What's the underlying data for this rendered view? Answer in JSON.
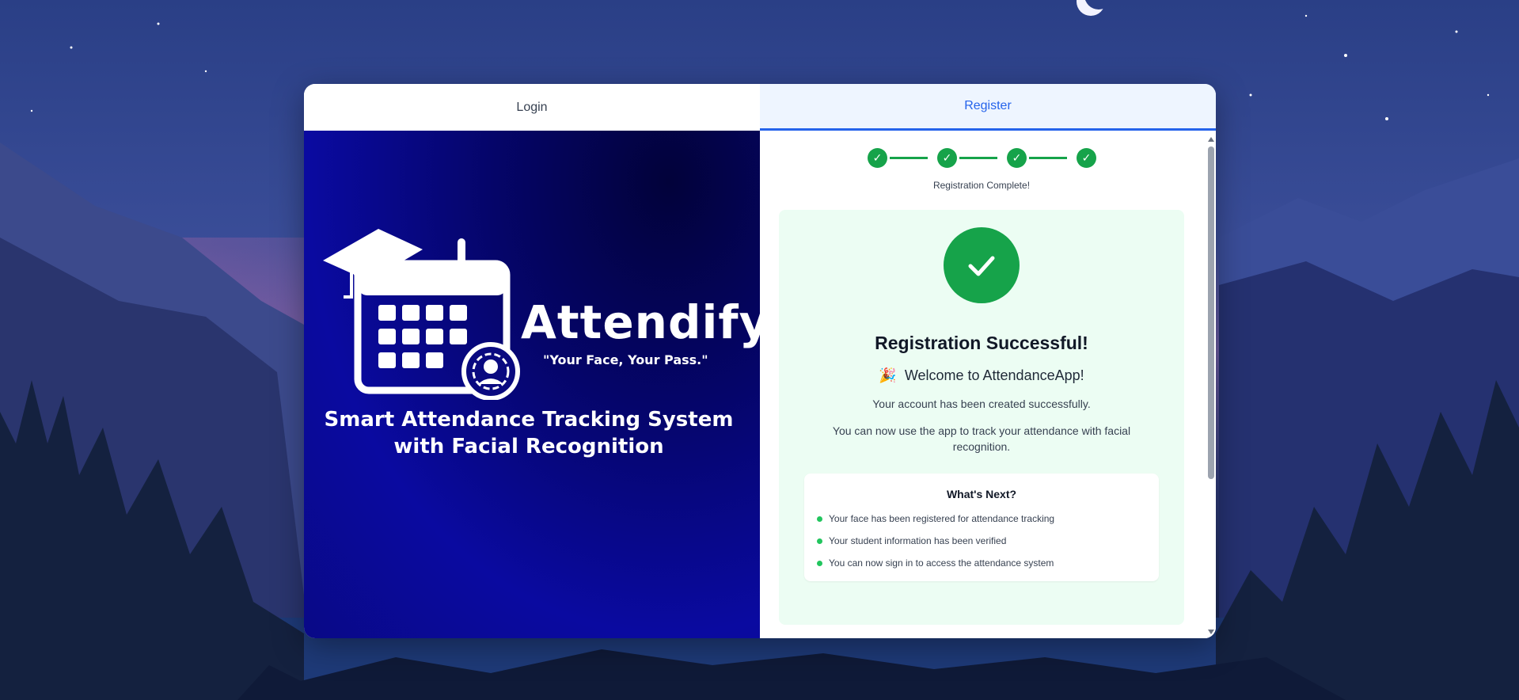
{
  "tabs": {
    "login": "Login",
    "register": "Register"
  },
  "brand": {
    "name": "Attendify",
    "tagline": "\"Your Face, Your Pass.\"",
    "subtitle_line1": "Smart Attendance Tracking System",
    "subtitle_line2": "with Facial Recognition"
  },
  "stepper": {
    "steps": [
      "✓",
      "✓",
      "✓",
      "✓"
    ],
    "caption": "Registration Complete!"
  },
  "success": {
    "title": "Registration Successful!",
    "welcome_emoji": "🎉",
    "welcome": "Welcome to AttendanceApp!",
    "created": "Your account has been created successfully.",
    "track": "You can now use the app to track your attendance with facial recognition."
  },
  "next": {
    "title": "What's Next?",
    "items": [
      "Your face has been registered for attendance tracking",
      "Your student information has been verified",
      "You can now sign in to access the attendance system"
    ]
  },
  "colors": {
    "accent": "#2563eb",
    "success": "#16a34a",
    "panel_bg": "#0a0aa0"
  }
}
